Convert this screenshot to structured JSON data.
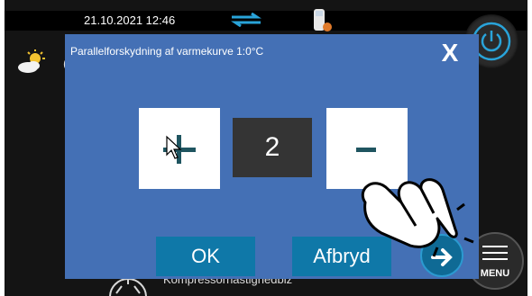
{
  "status_bar": {
    "datetime": "21.10.2021 12:46"
  },
  "background": {
    "partial_letter": "(",
    "bottom_label": "Kompressorhastighedbiz"
  },
  "dialog": {
    "title": "Parallelforskydning af varmekurve 1:0°C",
    "close_label": "X",
    "value": "2",
    "ok_label": "OK",
    "cancel_label": "Afbryd"
  },
  "menu": {
    "label": "MENU"
  },
  "colors": {
    "dialog_bg": "#4470b5",
    "button_blue": "#0f78a8",
    "screen_bg": "#141414",
    "accent_cyan": "#29a3d9",
    "glyph_color": "#1f5560"
  },
  "icons": {
    "sync": "sync-arrows-icon",
    "tank": "water-tank-icon",
    "weather": "sun-cloud-icon",
    "power": "power-icon",
    "menu": "hamburger-menu-icon",
    "plus": "plus-icon",
    "minus": "minus-icon",
    "next": "arrow-right-icon",
    "hand": "pointing-hand-icon",
    "cursor": "mouse-cursor-icon"
  }
}
